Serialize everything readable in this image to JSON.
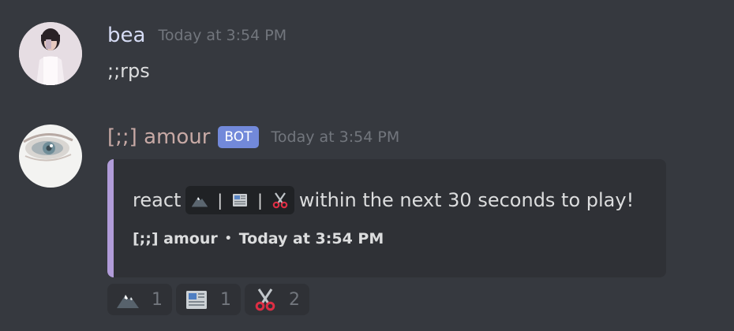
{
  "messages": [
    {
      "username": "bea",
      "timestamp": "Today at 3:54 PM",
      "content": ";;rps"
    },
    {
      "username": "[;;] amour",
      "badge": "BOT",
      "timestamp": "Today at 3:54 PM",
      "embed": {
        "accent_color": "#b19cd9",
        "desc_prefix": "react",
        "inline_emojis": [
          "rock-mountain-icon",
          "newspaper-icon",
          "scissors-icon"
        ],
        "separator": "|",
        "desc_suffix": "within the next 30 seconds to play!",
        "footer_author": "[;;] amour",
        "footer_separator": "•",
        "footer_time": "Today at 3:54 PM"
      },
      "reactions": [
        {
          "icon": "rock-mountain-icon",
          "count": "1"
        },
        {
          "icon": "newspaper-icon",
          "count": "1"
        },
        {
          "icon": "scissors-icon",
          "count": "2"
        }
      ]
    }
  ]
}
